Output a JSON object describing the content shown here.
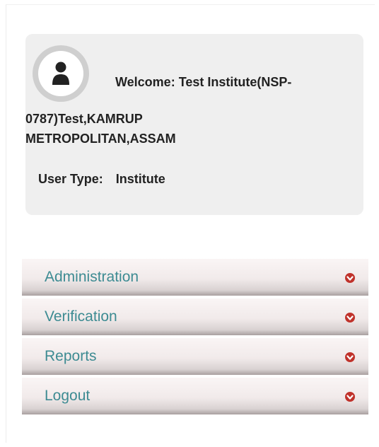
{
  "user": {
    "welcome_line1": "Welcome: Test Institute(NSP-",
    "welcome_line2": "0787)Test,KAMRUP\nMETROPOLITAN,ASSAM",
    "user_type_label": "User Type:",
    "user_type_value": "Institute",
    "avatar_icon": "user-icon"
  },
  "menu": [
    {
      "label": "Administration",
      "icon": "circle-arrow-down-icon"
    },
    {
      "label": "Verification",
      "icon": "circle-arrow-down-icon"
    },
    {
      "label": "Reports",
      "icon": "circle-arrow-down-icon"
    },
    {
      "label": "Logout",
      "icon": "circle-arrow-down-icon"
    }
  ],
  "colors": {
    "menu_text": "#3d8b92",
    "caret": "#c0322b",
    "card_bg": "#efefef"
  }
}
